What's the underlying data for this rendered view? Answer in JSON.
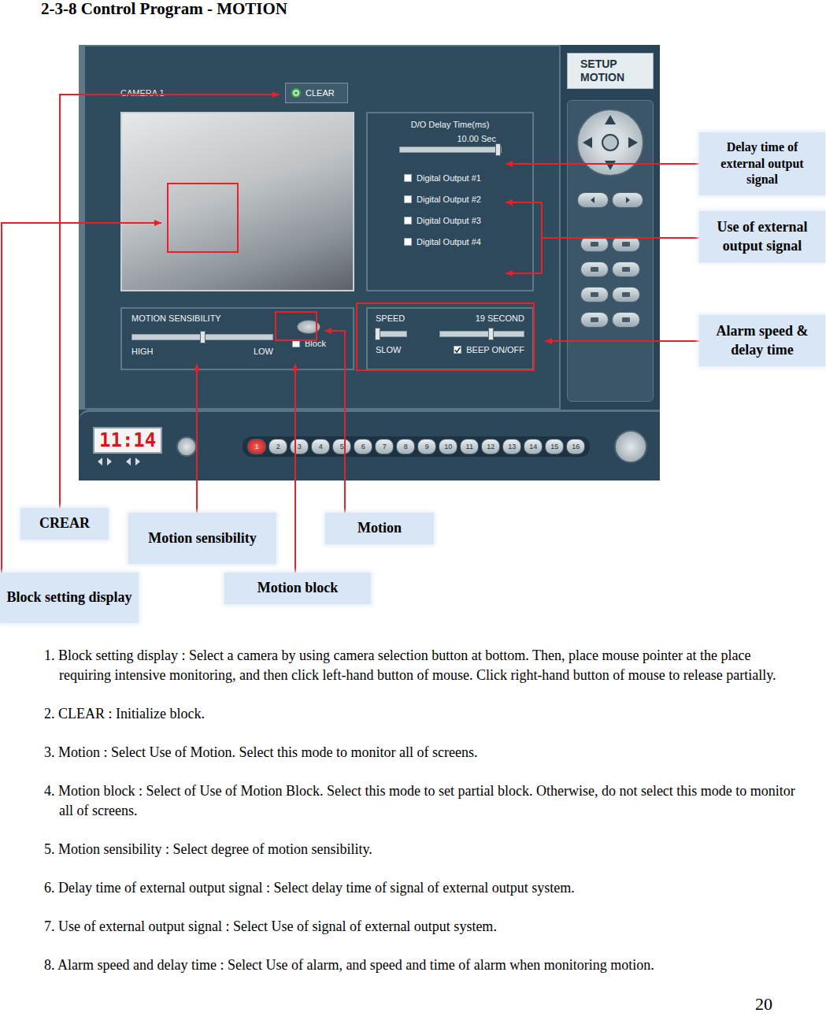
{
  "title": "2-3-8 Control Program - MOTION",
  "app": {
    "camera_label": "CAMERA 1",
    "clear_button": "CLEAR",
    "setup_header": [
      "SETUP",
      "MOTION"
    ],
    "do_panel": {
      "title": "D/O Delay Time(ms)",
      "reading": "10.00 Sec",
      "level": 0.97,
      "outputs": [
        {
          "label": "Digital Output #1",
          "checked": false
        },
        {
          "label": "Digital Output #2",
          "checked": false
        },
        {
          "label": "Digital Output #3",
          "checked": false
        },
        {
          "label": "Digital Output #4",
          "checked": false
        }
      ]
    },
    "sensibility": {
      "title": "MOTION SENSIBILITY",
      "level": 0.5,
      "high": "HIGH",
      "low": "LOW"
    },
    "block": {
      "label": "Block",
      "checked": false
    },
    "alarm": {
      "speed_label": "SPEED",
      "reading": "19 SECOND",
      "slow": "SLOW",
      "speed_level": 0.03,
      "delay_level": 0.6,
      "beep": {
        "label": "BEEP ON/OFF",
        "checked": true
      }
    },
    "clock": "11:14",
    "cameras": [
      {
        "label": "1",
        "selected": true
      },
      {
        "label": "2",
        "selected": false
      },
      {
        "label": "3",
        "selected": false
      },
      {
        "label": "4",
        "selected": false
      },
      {
        "label": "5",
        "selected": false
      },
      {
        "label": "6",
        "selected": false
      },
      {
        "label": "7",
        "selected": false
      },
      {
        "label": "8",
        "selected": false
      },
      {
        "label": "9",
        "selected": false
      },
      {
        "label": "10",
        "selected": false
      },
      {
        "label": "11",
        "selected": false
      },
      {
        "label": "12",
        "selected": false
      },
      {
        "label": "13",
        "selected": false
      },
      {
        "label": "14",
        "selected": false
      },
      {
        "label": "15",
        "selected": false
      },
      {
        "label": "16",
        "selected": false
      }
    ]
  },
  "callouts": {
    "delay_time": "Delay time of external output signal",
    "use_output": "Use of external output signal",
    "alarm": "Alarm speed & delay time",
    "crear": "CREAR",
    "sensibility": "Motion sensibility",
    "motion": "Motion",
    "block_setting": "Block setting display",
    "motion_block": "Motion block"
  },
  "instructions": [
    "1. Block setting display : Select a camera by using camera selection button at bottom. Then, place mouse pointer at the place requiring intensive monitoring, and then click left-hand button of mouse. Click right-hand button of mouse to release partially.",
    "2. CLEAR : Initialize block.",
    "3. Motion : Select Use of Motion. Select this mode to monitor all of screens.",
    "4. Motion block : Select of Use of Motion Block. Select this mode to set partial block. Otherwise, do not select this mode to monitor all of screens.",
    "5. Motion sensibility : Select degree of motion sensibility.",
    "6. Delay time of external output signal : Select delay time of signal of external output system.",
    "7. Use of external output signal : Select Use of signal of external output system.",
    "8. Alarm speed and delay time : Select Use of alarm, and speed and time of alarm when monitoring motion."
  ],
  "page_number": "20"
}
